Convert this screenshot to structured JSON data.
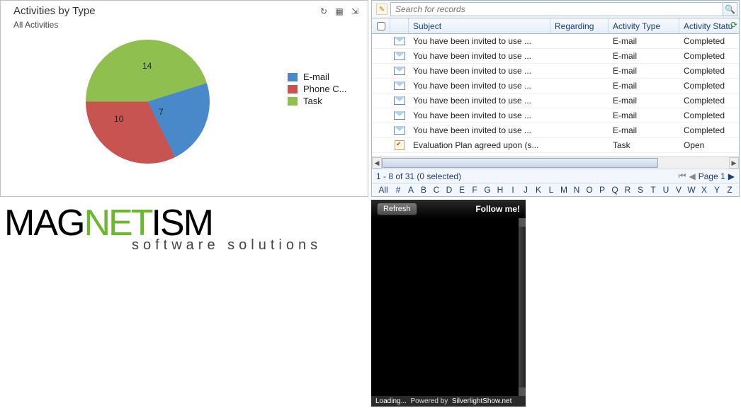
{
  "chart": {
    "title": "Activities by Type",
    "subtitle": "All Activities",
    "legend": [
      {
        "label": "E-mail",
        "color": "#4a89c9"
      },
      {
        "label": "Phone C...",
        "color": "#c75450"
      },
      {
        "label": "Task",
        "color": "#8fbf4f"
      }
    ],
    "slice_labels": {
      "green": "14",
      "blue": "7",
      "red": "10"
    }
  },
  "chart_data": {
    "type": "pie",
    "title": "Activities by Type",
    "categories": [
      "E-mail",
      "Phone Call",
      "Task"
    ],
    "values": [
      7,
      10,
      14
    ],
    "colors": [
      "#4a89c9",
      "#c75450",
      "#8fbf4f"
    ]
  },
  "grid": {
    "search_placeholder": "Search for records",
    "columns": {
      "subject": "Subject",
      "regarding": "Regarding",
      "type": "Activity Type",
      "status": "Activity Statu"
    },
    "rows": [
      {
        "icon": "mail",
        "subject": "You have been invited to use ...",
        "regarding": "",
        "type": "E-mail",
        "status": "Completed"
      },
      {
        "icon": "mail",
        "subject": "You have been invited to use ...",
        "regarding": "",
        "type": "E-mail",
        "status": "Completed"
      },
      {
        "icon": "mail",
        "subject": "You have been invited to use ...",
        "regarding": "",
        "type": "E-mail",
        "status": "Completed"
      },
      {
        "icon": "mail",
        "subject": "You have been invited to use ...",
        "regarding": "",
        "type": "E-mail",
        "status": "Completed"
      },
      {
        "icon": "mail",
        "subject": "You have been invited to use ...",
        "regarding": "",
        "type": "E-mail",
        "status": "Completed"
      },
      {
        "icon": "mail",
        "subject": "You have been invited to use ...",
        "regarding": "",
        "type": "E-mail",
        "status": "Completed"
      },
      {
        "icon": "mail",
        "subject": "You have been invited to use ...",
        "regarding": "",
        "type": "E-mail",
        "status": "Completed"
      },
      {
        "icon": "task",
        "subject": "Evaluation Plan agreed upon (s...",
        "regarding": "",
        "type": "Task",
        "status": "Open"
      }
    ],
    "status_text": "1 - 8 of 31 (0 selected)",
    "page_label": "Page 1",
    "alpha": [
      "All",
      "#",
      "A",
      "B",
      "C",
      "D",
      "E",
      "F",
      "G",
      "H",
      "I",
      "J",
      "K",
      "L",
      "M",
      "N",
      "O",
      "P",
      "Q",
      "R",
      "S",
      "T",
      "U",
      "V",
      "W",
      "X",
      "Y",
      "Z"
    ]
  },
  "logo": {
    "main_pre": "MAG",
    "main_mid": "NET",
    "main_post": "ISM",
    "sub": "software solutions"
  },
  "widget": {
    "refresh": "Refresh",
    "follow": "Follow me!",
    "loading": "Loading...",
    "powered": "Powered by",
    "powered_site": "SilverlightShow.net"
  }
}
